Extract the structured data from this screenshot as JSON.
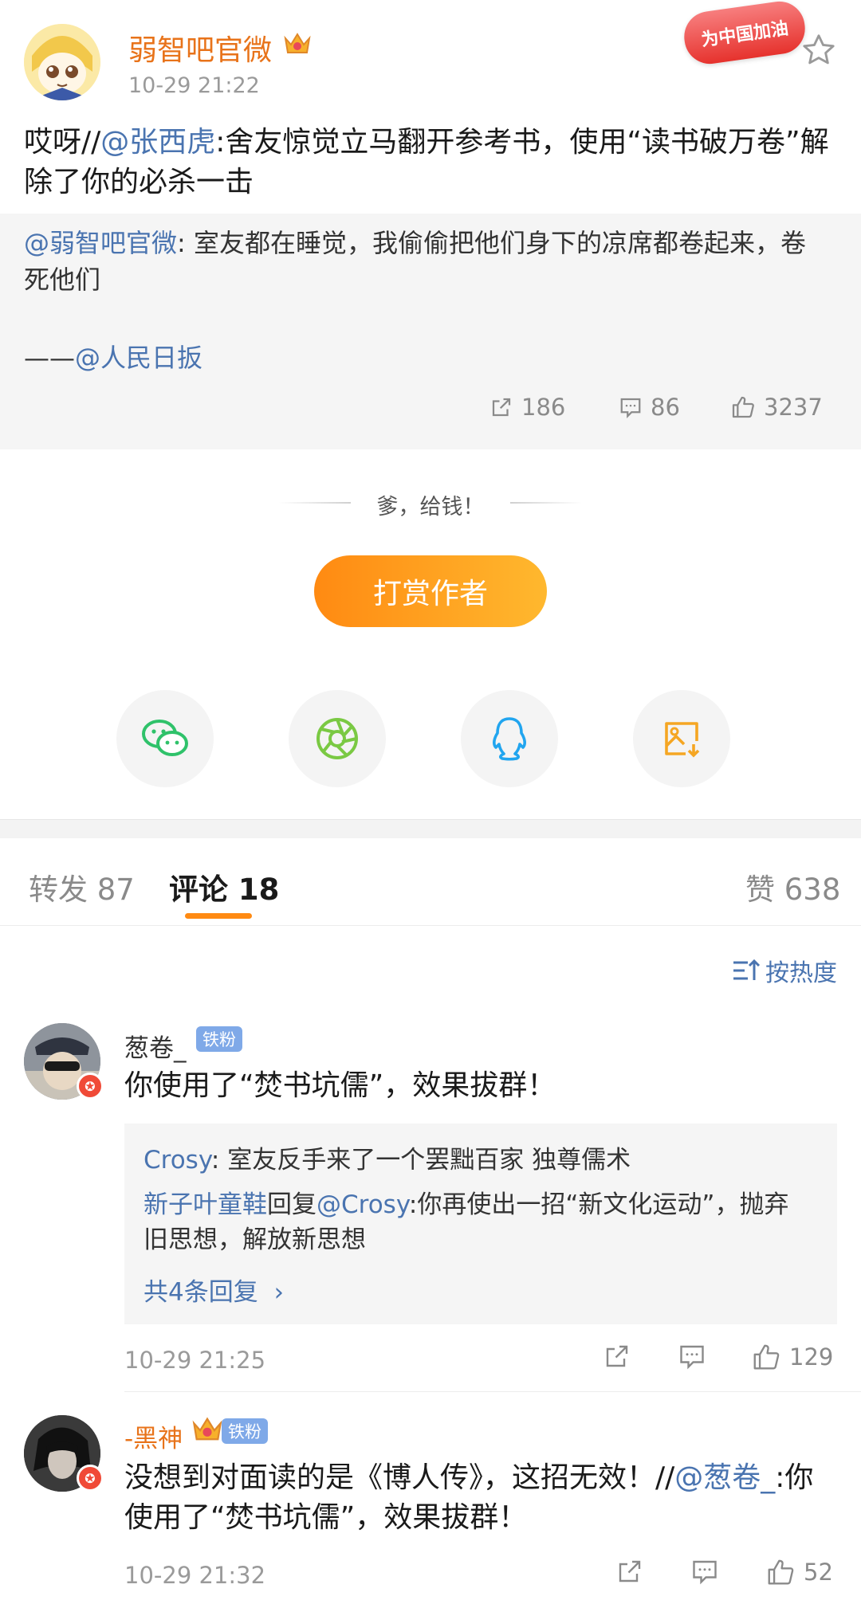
{
  "post": {
    "author": "弱智吧官微",
    "time": "10-29 21:22",
    "badge": "为中国加油",
    "text_prefix": "哎呀//",
    "text_mention": "@张西虎",
    "text_body": ":舍友惊觉立马翻开参考书，使用“读书破万卷”解除了你的必杀一击",
    "retweet": {
      "mention": "@弱智吧官微",
      "text": ": 室友都在睡觉，我偷偷把他们身下的凉席都卷起来，卷死他们",
      "signature_prefix": "——",
      "signature_mention": "@人民日扳",
      "shares": "186",
      "comments": "86",
      "likes": "3237"
    }
  },
  "reward": {
    "slogan": "爹，给钱！",
    "button_label": "打赏作者"
  },
  "share_targets": [
    "wechat-icon",
    "moments-icon",
    "qq-icon",
    "save-image-icon"
  ],
  "tabs": {
    "repost": "转发 87",
    "comments": "评论 18",
    "likes": "赞 638"
  },
  "sort_label": "按热度",
  "comments": [
    {
      "name": "葱卷_",
      "tag": "铁粉",
      "text": "你使用了“焚书坑儒”，效果拔群！",
      "replies": [
        {
          "user": "Crosy",
          "text": ": 室友反手来了一个罢黜百家 独尊儒术"
        },
        {
          "user": "新子叶童鞋",
          "mid": "回复",
          "mention": "@Crosy",
          "text": ":你再使出一招“新文化运动”，抛弃旧思想，解放新思想"
        }
      ],
      "more_replies": "共4条回复",
      "time": "10-29 21:25",
      "likes": "129"
    },
    {
      "name": "-黑神",
      "tag": "铁粉",
      "text": "没想到对面读的是《博人传》，这招无效！//",
      "mention": "@葱卷_",
      "text_suffix": ":你使用了“焚书坑儒”，效果拔群！",
      "time": "10-29 21:32",
      "likes": "52"
    }
  ],
  "colors": {
    "accent": "#ff8a12",
    "username": "#e8731a",
    "link": "#4a74b0"
  }
}
